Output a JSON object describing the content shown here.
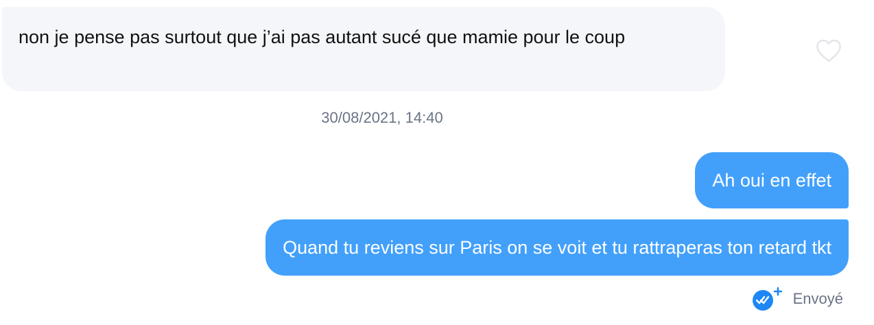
{
  "messages": {
    "received": {
      "text": "non je pense pas surtout que j’ai pas autant sucé que mamie pour le coup"
    },
    "timestamp": "30/08/2021, 14:40",
    "sent": [
      {
        "text": "Ah oui en effet"
      },
      {
        "text": "Quand tu reviens sur Paris on se voit et tu rattraperas ton retard tkt"
      }
    ],
    "status": {
      "label": "Envoyé",
      "icon": "double-check-icon"
    }
  },
  "icons": {
    "like": "heart-outline-icon",
    "read_receipt": "double-check-plus-icon"
  },
  "colors": {
    "sent_bubble": "#42a0fb",
    "received_bubble": "#f5f6fa",
    "status_icon": "#1f87f5",
    "meta_text": "#6a7385"
  }
}
